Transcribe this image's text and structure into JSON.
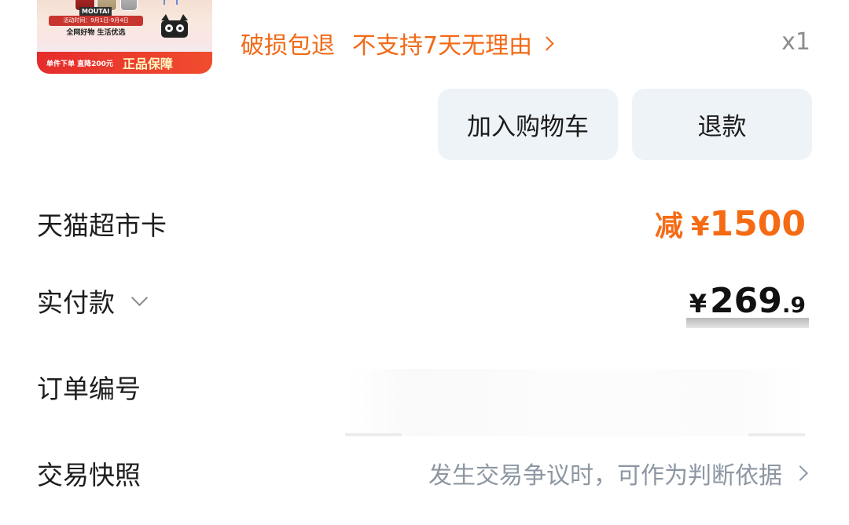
{
  "product": {
    "image_alt": "Product thumbnail",
    "brand_text": "MOUTAI",
    "date_text": "活动时间：9月1日-9月4日",
    "tagline": "全网好物 生活优选",
    "promo_text": "单件下单 直降200元",
    "genuine_text": "正品保障"
  },
  "service": {
    "damage_return": "破损包退",
    "no_return_7days": "不支持7天无理由",
    "quantity": "x1"
  },
  "actions": {
    "add_to_cart": "加入购物车",
    "refund": "退款"
  },
  "rows": {
    "tmall_card": {
      "label": "天猫超市卡",
      "prefix": "减",
      "currency": "¥",
      "value": "1500"
    },
    "paid": {
      "label": "实付款",
      "currency": "¥",
      "integer": "269",
      "decimal": ".9"
    },
    "order_number": {
      "label": "订单编号"
    },
    "snapshot": {
      "label": "交易快照",
      "hint": "发生交易争议时，可作为判断依据"
    }
  },
  "colors": {
    "accent_orange": "#f16a17",
    "button_bg": "#eef3f8",
    "hint_gray": "#8d97a3"
  }
}
